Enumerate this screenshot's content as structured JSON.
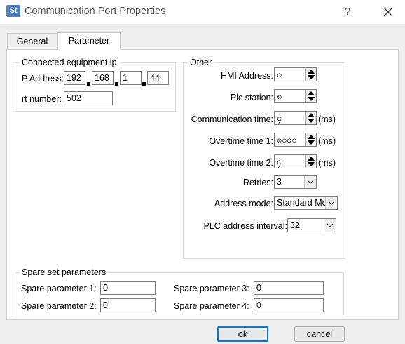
{
  "window": {
    "title": "Communication Port Properties",
    "icon_text": "St",
    "help": "?"
  },
  "tabs": [
    {
      "label": "General"
    },
    {
      "label": "Parameter"
    }
  ],
  "connected": {
    "legend": "Connected equipment ip",
    "ip_label": "P Address:",
    "ip": [
      "192",
      "168",
      "1",
      "44"
    ],
    "port_label": "rt number:",
    "port": "502"
  },
  "other": {
    "legend": "Other",
    "hmi_address_label": "HMI Address:",
    "hmi_address": "၀",
    "plc_station_label": "Plc station:",
    "plc_station": "၈",
    "comm_time_label": "Communication time:",
    "comm_time": "၄",
    "overtime1_label": "Overtime time 1:",
    "overtime1": "၈၀၀၀",
    "overtime2_label": "Overtime time 2:",
    "overtime2": "၄",
    "unit": "(ms)",
    "retries_label": "Retries:",
    "retries": "3",
    "address_mode_label": "Address mode:",
    "address_mode": "Standard Mc",
    "plc_interval_label": "PLC address interval:",
    "plc_interval": "32"
  },
  "spare": {
    "legend": "Spare set parameters",
    "p1_label": "Spare parameter 1:",
    "p1": "0",
    "p2_label": "Spare parameter 2:",
    "p2": "0",
    "p3_label": "Spare parameter 3:",
    "p3": "0",
    "p4_label": "Spare parameter 4:",
    "p4": "0"
  },
  "buttons": {
    "ok": "ok",
    "cancel": "cancel"
  }
}
